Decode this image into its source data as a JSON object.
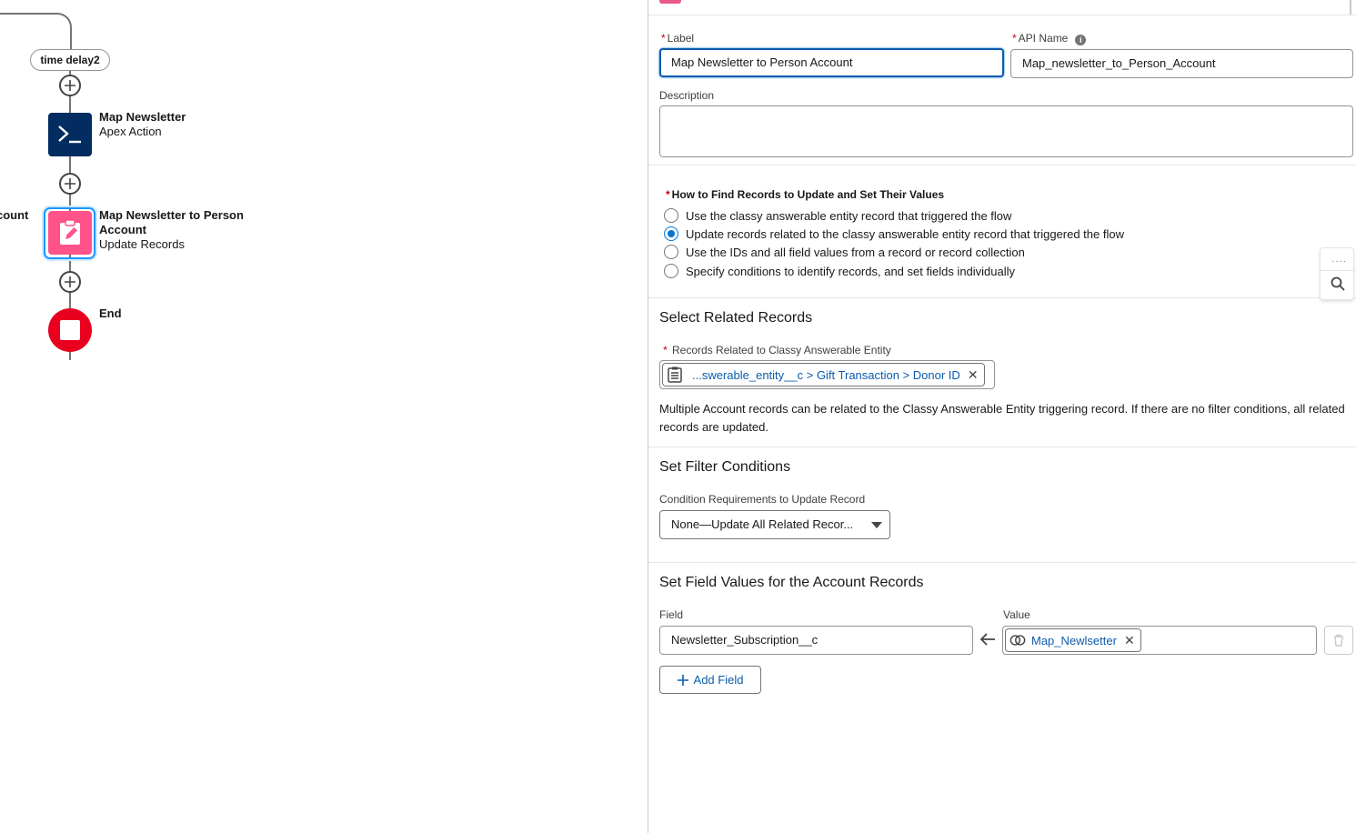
{
  "canvas": {
    "time_delay_label": "time delay2",
    "offscreen_label": "count",
    "nodes": [
      {
        "title": "Map Newsletter",
        "subtitle": "Apex Action",
        "icon": "apex-action-icon",
        "color": "#032d60"
      },
      {
        "title": "Map Newsletter to Person Account",
        "subtitle": "Update Records",
        "icon": "update-records-icon",
        "color": "#ff538a"
      },
      {
        "title": "End",
        "subtitle": "",
        "icon": "end-icon",
        "color": "#ea001e"
      }
    ]
  },
  "panel": {
    "label_field": {
      "label": "Label",
      "value": "Map Newsletter to Person Account"
    },
    "api_name_field": {
      "label": "API Name",
      "value": "Map_newsletter_to_Person_Account"
    },
    "description_field": {
      "label": "Description",
      "value": ""
    },
    "how_to_find": {
      "title": "How to Find Records to Update and Set Their Values",
      "options": [
        {
          "label": "Use the classy answerable entity record that triggered the flow",
          "selected": false
        },
        {
          "label": "Update records related to the classy answerable entity record that triggered the flow",
          "selected": true
        },
        {
          "label": "Use the IDs and all field values from a record or record collection",
          "selected": false
        },
        {
          "label": "Specify conditions to identify records, and set fields individually",
          "selected": false
        }
      ]
    },
    "select_related": {
      "title": "Select Related Records",
      "field_label": "Records Related to Classy Answerable Entity",
      "token_text": "...swerable_entity__c > Gift Transaction > Donor ID",
      "help_text": "Multiple Account records can be related to the Classy Answerable Entity triggering record. If there are no filter conditions, all related records are updated."
    },
    "filter": {
      "title": "Set Filter Conditions",
      "field_label": "Condition Requirements to Update Record",
      "selected_value": "None—Update All Related Recor..."
    },
    "field_values": {
      "title": "Set Field Values for the Account Records",
      "field_col_label": "Field",
      "value_col_label": "Value",
      "rows": [
        {
          "field": "Newsletter_Subscription__c",
          "value": "Map_Newlsetter"
        }
      ],
      "add_field_label": "Add Field"
    }
  },
  "colors": {
    "accent": "#0176d3",
    "required": "#ba0517",
    "link": "#0b5cab"
  }
}
